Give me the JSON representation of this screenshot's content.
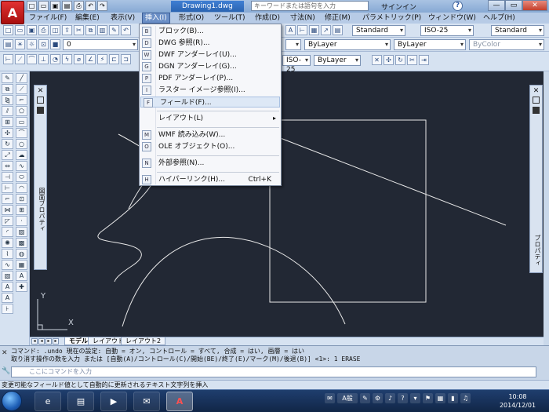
{
  "titlebar": {
    "doc_title": "Drawing1.dwg",
    "search_placeholder": "キーワードまたは語句を入力",
    "signin": "サインイン",
    "help": "?",
    "logo_letter": "A"
  },
  "menubar": {
    "items": [
      {
        "label": "ファイル(F)"
      },
      {
        "label": "編集(E)"
      },
      {
        "label": "表示(V)"
      },
      {
        "label": "挿入(I)"
      },
      {
        "label": "形式(O)"
      },
      {
        "label": "ツール(T)"
      },
      {
        "label": "作成(D)"
      },
      {
        "label": "寸法(N)"
      },
      {
        "label": "修正(M)"
      },
      {
        "label": "パラメトリック(P)"
      },
      {
        "label": "ウィンドウ(W)"
      },
      {
        "label": "ヘルプ(H)"
      }
    ]
  },
  "toolbars": {
    "layer_value": "0",
    "text_style": "Standard",
    "dim_style": "ISO-25",
    "table_style": "Standard",
    "dim_style2": "ISO-25",
    "linetype": "ByLayer",
    "lineweight": "ByLayer",
    "plot_style": "ByColor"
  },
  "insert_menu": {
    "items": [
      {
        "label": "ブロック(B)...",
        "icon": "B"
      },
      {
        "label": "DWG 参照(R)...",
        "icon": "D"
      },
      {
        "label": "DWF アンダーレイ(U)...",
        "icon": "W"
      },
      {
        "label": "DGN アンダーレイ(G)...",
        "icon": "G"
      },
      {
        "label": "PDF アンダーレイ(P)...",
        "icon": "P"
      },
      {
        "label": "ラスター イメージ参照(I)...",
        "icon": "I"
      },
      {
        "label": "フィールド(F)...",
        "icon": "F"
      },
      {
        "label": "レイアウト(L)",
        "arrow": "▸"
      },
      {
        "label": "WMF 読み込み(W)...",
        "icon": "M"
      },
      {
        "label": "OLE オブジェクト(O)...",
        "icon": "O"
      },
      {
        "label": "外部参照(N)...",
        "icon": "N"
      },
      {
        "label": "ハイパーリンク(H)...",
        "shortcut": "Ctrl+K",
        "icon": "H"
      }
    ]
  },
  "palettes": {
    "left_label": "図面ブロパティ",
    "right_label": "プロパティ"
  },
  "layout_tabs": {
    "tabs": [
      "モデル",
      "レイアウト1",
      "レイアウト2"
    ]
  },
  "command": {
    "line1": "コマンド:  .undo 現在の設定: 自動 = オン, コントロール = すべて, 合成 = はい, 画層 = はい",
    "line2": "取り消す操作の数を入力 または [自動(A)/コントロール(C)/開始(BE)/終了(E)/マーク(M)/後退(B)] <1>: 1 ERASE",
    "input_placeholder": "ここにコマンドを入力"
  },
  "statusbar": {
    "text": "変更可能なフィールド値として自動的に更新されるテキスト文字列を挿入"
  },
  "taskbar": {
    "time": "10:08",
    "date": "2014/12/01",
    "ime": "A般",
    "apps": [
      "e",
      "▤",
      "▶",
      "✉",
      "A"
    ]
  },
  "ucs": {
    "x": "X",
    "y": "Y"
  }
}
